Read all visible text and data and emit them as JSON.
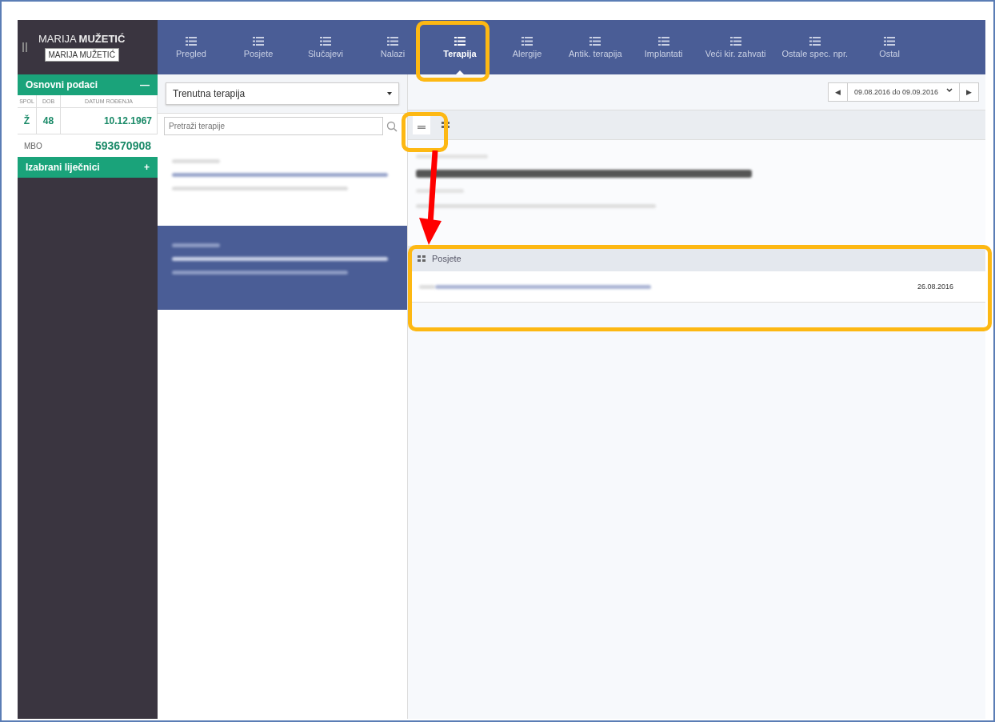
{
  "patient": {
    "first_name": "MARIJA",
    "last_name": "MUŽETIĆ",
    "badge": "MARIJA MUŽETIĆ"
  },
  "tabs": [
    {
      "label": "Pregled",
      "selected": false
    },
    {
      "label": "Posjete",
      "selected": false
    },
    {
      "label": "Slučajevi",
      "selected": false
    },
    {
      "label": "Nalazi",
      "selected": false
    },
    {
      "label": "Terapija",
      "selected": true
    },
    {
      "label": "Alergije",
      "selected": false
    },
    {
      "label": "Antik. terapija",
      "selected": false
    },
    {
      "label": "Implantati",
      "selected": false
    },
    {
      "label": "Veći kir. zahvati",
      "selected": false
    },
    {
      "label": "Ostale spec. npr.",
      "selected": false
    },
    {
      "label": "Ostal",
      "selected": false
    }
  ],
  "basic_data": {
    "title": "Osnovni podaci",
    "toggle": "—",
    "columns": [
      "SPOL",
      "DOB",
      "DATUM ROĐENJA"
    ],
    "values": [
      "Ž",
      "48",
      "10.12.1967"
    ],
    "mbo_label": "MBO",
    "mbo_value": "593670908"
  },
  "doctors": {
    "title": "Izabrani liječnici",
    "toggle": "+"
  },
  "therapy_filter": {
    "value": "Trenutna terapija"
  },
  "search": {
    "placeholder": "Pretraži terapije"
  },
  "therapy_list": [
    {
      "selected": false
    },
    {
      "selected": true
    }
  ],
  "date_range": {
    "value": "09.08.2016 do 09.09.2016",
    "prev": "◀",
    "next": "▶"
  },
  "visits": {
    "title": "Posjete",
    "rows": [
      {
        "date": "26.08.2016"
      }
    ]
  }
}
